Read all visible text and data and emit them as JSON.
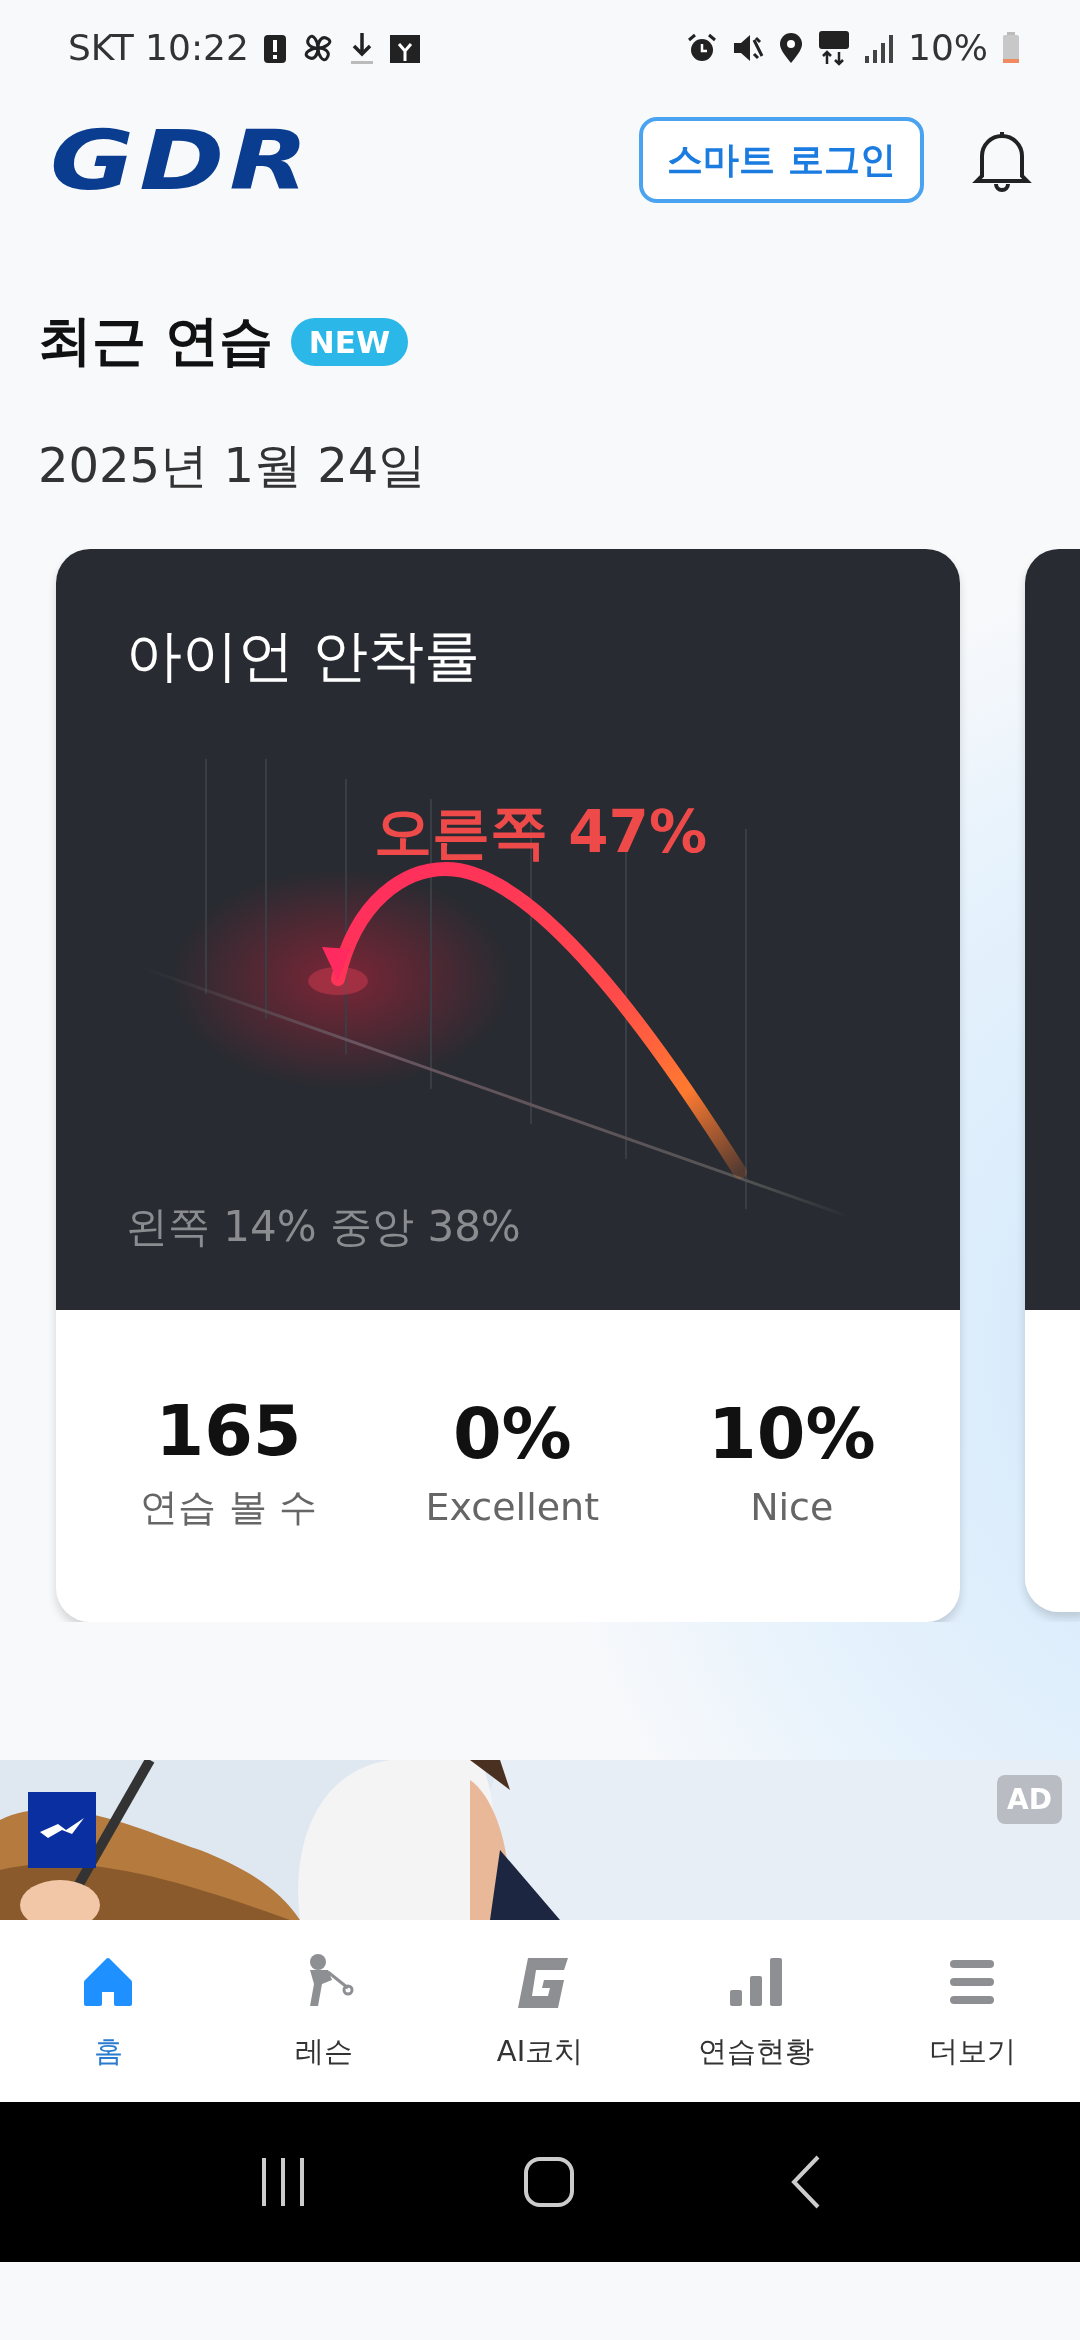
{
  "status_bar": {
    "carrier_time": "SKT 10:22",
    "battery": "10%"
  },
  "header": {
    "logo": "GDR",
    "login_button": "스마트 로그인"
  },
  "section": {
    "title": "최근 연습",
    "badge": "NEW",
    "date": "2025년 1월 24일"
  },
  "card": {
    "title": "아이언 안착률",
    "highlight": "오른쪽 47%",
    "others": "왼쪽 14% 중앙 38%",
    "stats": [
      {
        "value": "165",
        "label": "연습 볼 수"
      },
      {
        "value": "0%",
        "label": "Excellent"
      },
      {
        "value": "10%",
        "label": "Nice"
      }
    ]
  },
  "ad": {
    "badge": "AD"
  },
  "bottom_nav": [
    {
      "kind": "home",
      "label": "홈",
      "selected": true
    },
    {
      "kind": "lesson",
      "label": "레슨",
      "selected": false
    },
    {
      "kind": "coach",
      "label": "AI코치",
      "selected": false
    },
    {
      "kind": "stats",
      "label": "연습현황",
      "selected": false
    },
    {
      "kind": "more",
      "label": "더보기",
      "selected": false
    }
  ]
}
